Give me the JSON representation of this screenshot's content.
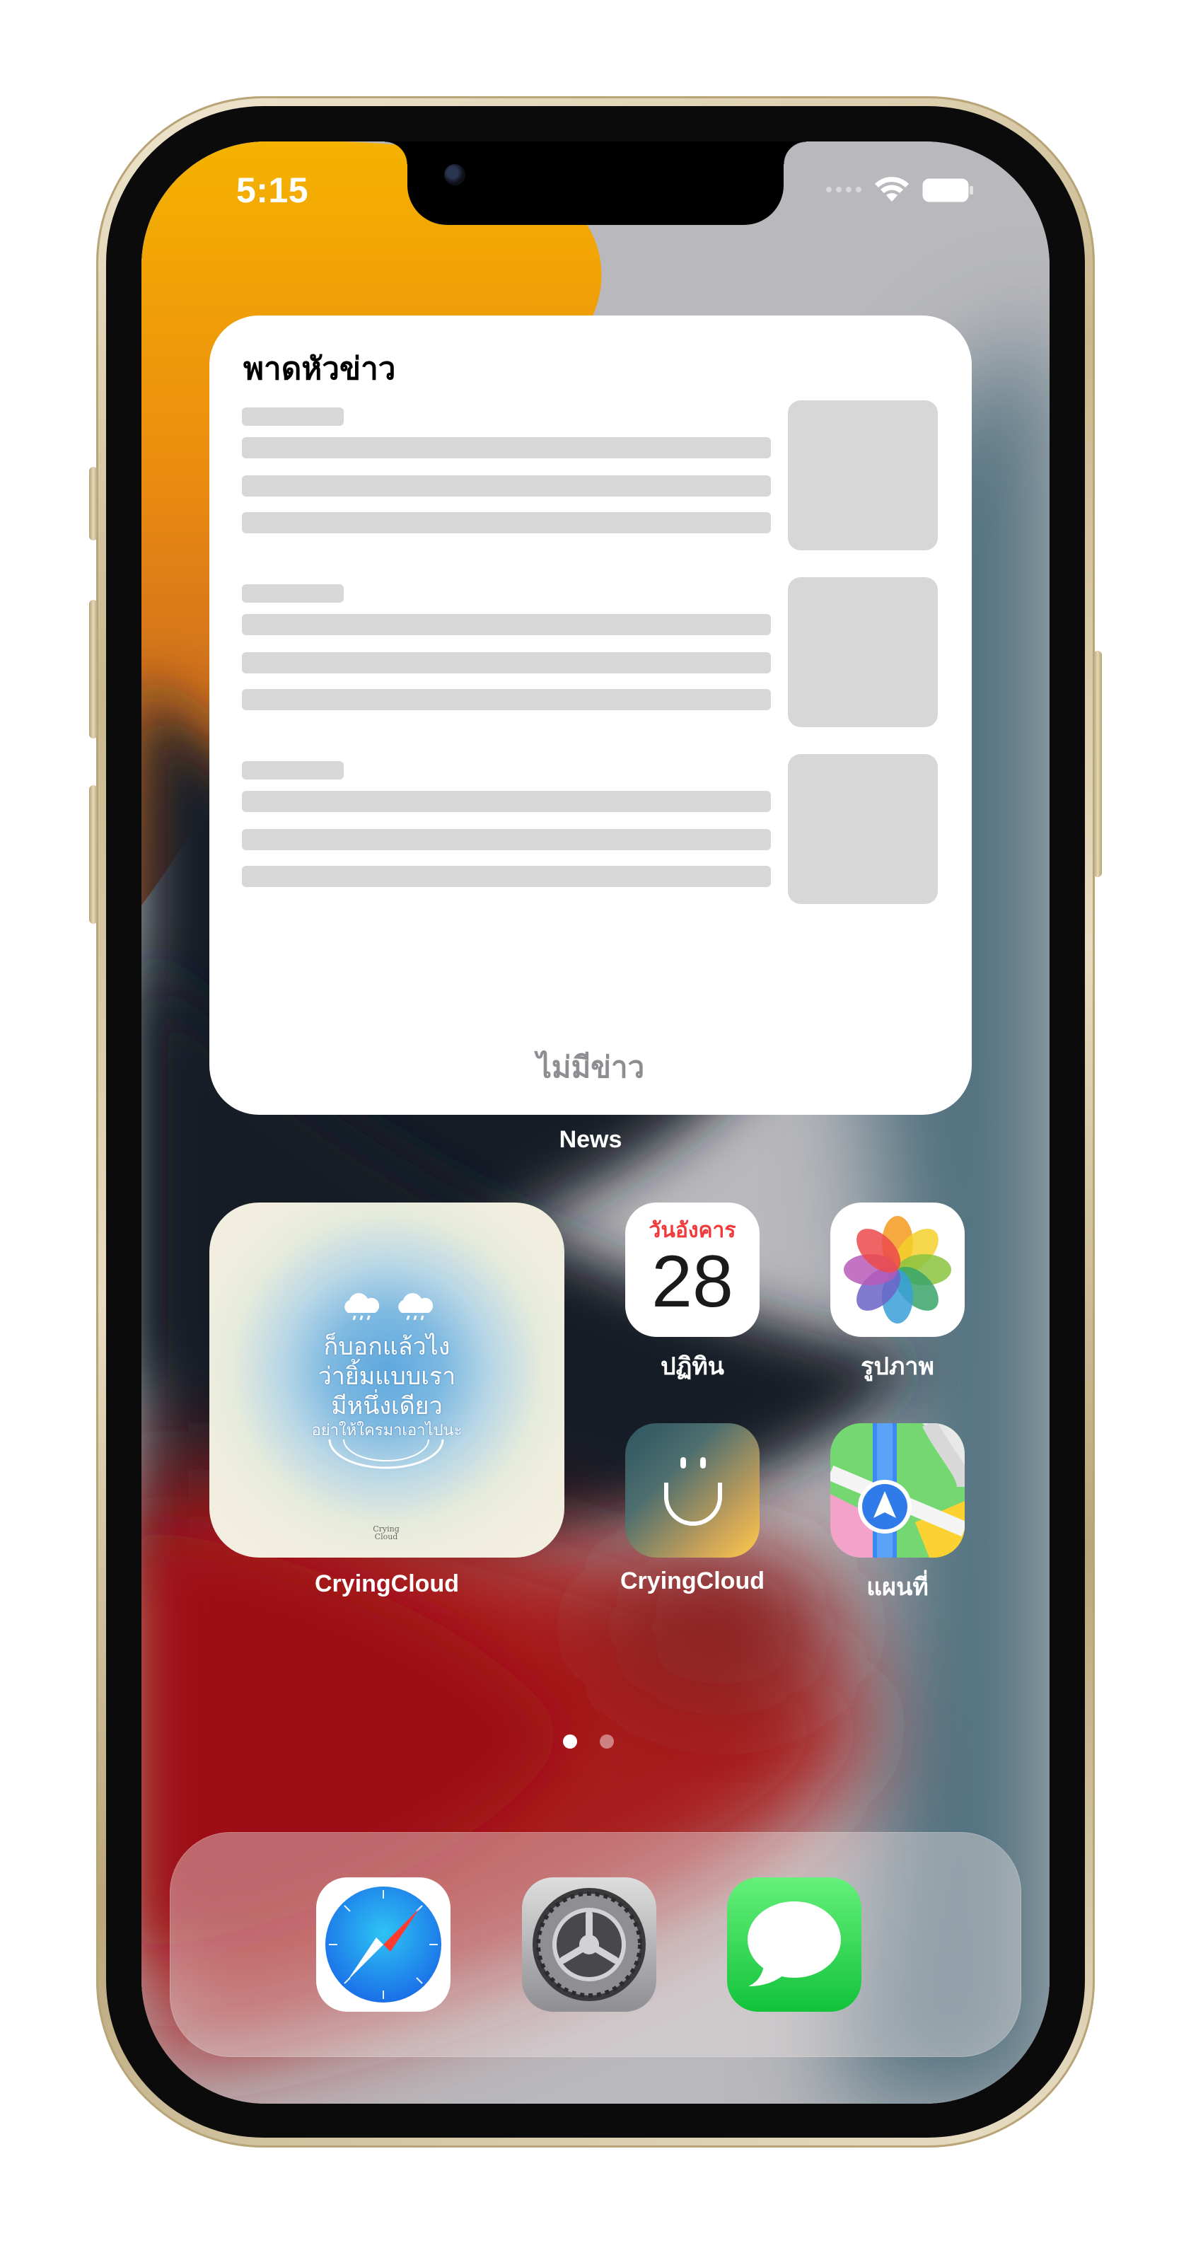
{
  "status_bar": {
    "time": "5:15"
  },
  "news_widget": {
    "title": "พาดหัวข่าว",
    "empty_message": "ไม่มีข่าว",
    "label": "News"
  },
  "widgets": {
    "crying_cloud": {
      "label": "CryingCloud",
      "quote_lines": [
        "ก็บอกแล้วไง",
        "ว่ายิ้มแบบเรา",
        "มีหนึ่งเดียว",
        "อย่าให้ใครมาเอาไปนะ"
      ],
      "logo_text": "Crying Cloud"
    }
  },
  "apps": {
    "calendar": {
      "label": "ปฏิทิน",
      "weekday": "วันอังคาร",
      "day": "28",
      "accent": "#f0393a"
    },
    "photos": {
      "label": "รูปภาพ"
    },
    "crying_cloud_app": {
      "label": "CryingCloud"
    },
    "maps": {
      "label": "แผนที่"
    }
  },
  "page_indicator": {
    "pages": 2,
    "current": 1
  },
  "dock": {
    "apps": [
      "Safari",
      "Settings",
      "Messages"
    ]
  },
  "colors": {
    "frame_gold": "#c9b88e",
    "widget_placeholder": "#d7d7d7",
    "empty_text": "#8e8e92"
  }
}
